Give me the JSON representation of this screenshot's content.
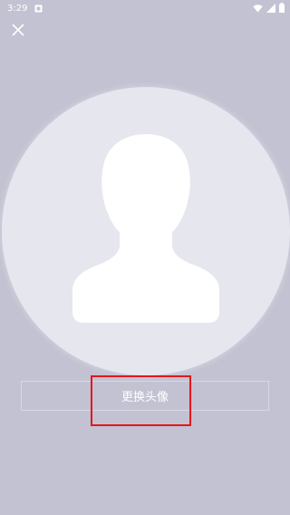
{
  "status_bar": {
    "time": "3:29",
    "icons": [
      "notification-icon",
      "wifi-icon",
      "signal-icon",
      "battery-icon"
    ]
  },
  "header": {
    "close_icon": "close-icon"
  },
  "avatar": {
    "icon": "default-avatar-icon"
  },
  "actions": {
    "change_avatar_label": "更换头像"
  },
  "colors": {
    "background": "#c3c2d2",
    "avatar_bg": "#e6e6ef",
    "highlight": "#e5161b",
    "text": "#ffffff"
  }
}
